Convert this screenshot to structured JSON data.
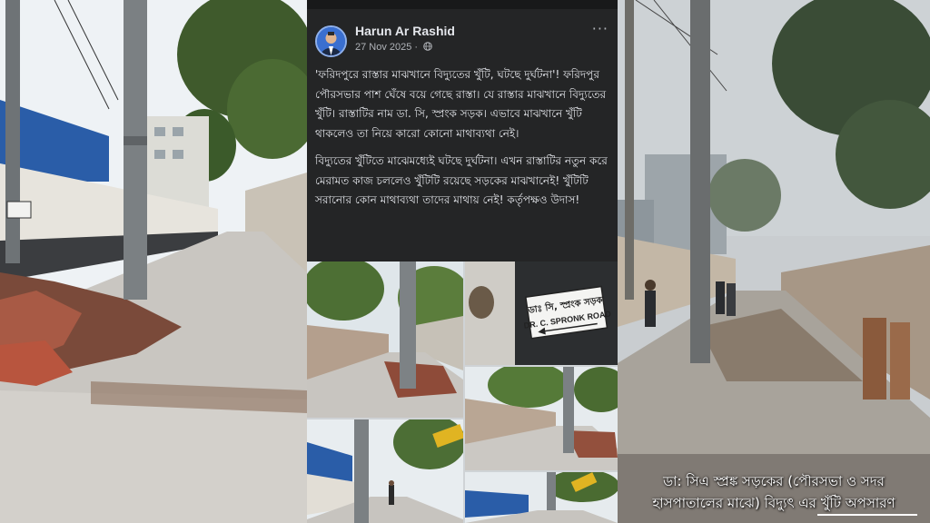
{
  "post": {
    "author": "Harun Ar Rashid",
    "date": "27 Nov 2025 · ",
    "globe_icon": "globe-icon",
    "more_icon": "more-options-icon",
    "paragraphs": [
      "'ফরিদপুরে রাস্তার মাঝখানে বিদ্যুতের খুঁটি, ঘটছে দুর্ঘটনা'! ফরিদপুর পৌরসভার পাশ ঘেঁষে বয়ে গেছে রাস্তা। যে রাস্তার মাঝখানে বিদ্যুতের খুঁটি। রাস্তাটির নাম ডা. সি, স্প্রংক সড়ক। এভাবে মাঝখানে খুঁটি থাকলেও তা নিয়ে কারো কোনো মাথাব্যথা নেই।",
      "বিদ্যুতের খুঁটিতে মাঝেমধ্যেই ঘটছে দুর্ঘটনা। এখন রাস্তাটির নতুন করে মেরামত কাজ চললেও খুঁটিটি রয়েছে সড়কের মাঝখানেই! খুঁটিটি সরানোর কোন মাথাব্যথা তাদের মাথায় নেই! কর্তৃপক্ষও উদাস!"
    ]
  },
  "road_sign": {
    "line1": "ডাঃ সি, স্প্রংক সড়ক",
    "line2": "DR. C. SPRONK ROAD"
  },
  "video_caption": {
    "line1": "ডা: সিএ স্প্রঙ্ক সড়কের (পৌরসভা ও সদর",
    "line2": "হাসপাতালের মাঝে) বিদ্যুৎ এর খুঁটি অপসারণ"
  },
  "colors": {
    "card_bg": "#242526",
    "text": "#e4e6eb",
    "muted": "#b0b3b8",
    "sky": "#e9eef1",
    "wall_blue": "#2a5da8"
  }
}
